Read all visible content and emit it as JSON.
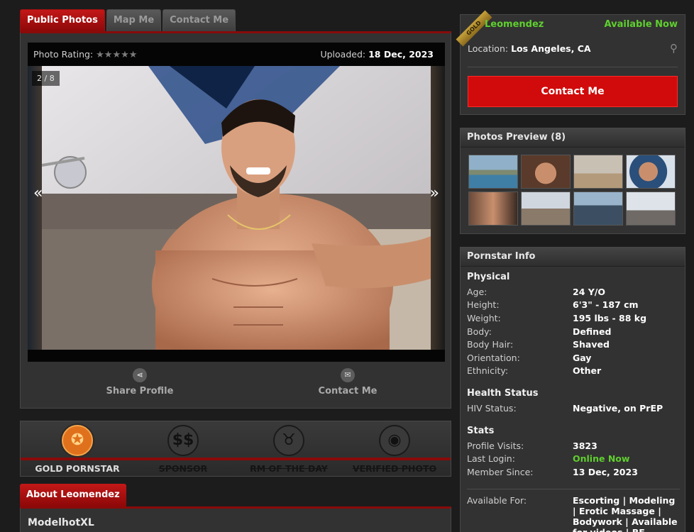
{
  "tabs": [
    {
      "label": "Public Photos",
      "active": true
    },
    {
      "label": "Map Me",
      "active": false
    },
    {
      "label": "Contact Me",
      "active": false
    }
  ],
  "photo": {
    "rating_label": "Photo Rating:",
    "stars": "★★★★★",
    "uploaded_label": "Uploaded:",
    "uploaded_date": "18 Dec, 2023",
    "counter": "2 / 8",
    "prev": "«",
    "next": "»"
  },
  "actions": {
    "share_label": "Share Profile",
    "contact_label": "Contact Me"
  },
  "badges": [
    {
      "label": "GOLD PORNSTAR",
      "active": true,
      "icon": "medal-icon",
      "glyph": "✪"
    },
    {
      "label": "SPONSOR",
      "active": false,
      "icon": "dollar-icon",
      "glyph": "$$"
    },
    {
      "label": "RM OF THE DAY",
      "active": false,
      "icon": "devil-icon",
      "glyph": "♉"
    },
    {
      "label": "VERIFIED PHOTO",
      "active": false,
      "icon": "camera-icon",
      "glyph": "◉"
    }
  ],
  "about": {
    "tab_label": "About Leomendez",
    "name": "ModelhotXL"
  },
  "profile": {
    "ribbon": "GOLD",
    "username": "Leomendez",
    "availability": "Available Now",
    "location_label": "Location:",
    "location": "Los Angeles, CA",
    "contact_button": "Contact Me"
  },
  "preview": {
    "title": "Photos Preview (8)"
  },
  "info": {
    "title": "Pornstar Info",
    "physical_title": "Physical",
    "physical": [
      {
        "k": "Age:",
        "v": "24 Y/O"
      },
      {
        "k": "Height:",
        "v": "6'3\" - 187 cm"
      },
      {
        "k": "Weight:",
        "v": "195 lbs - 88 kg"
      },
      {
        "k": "Body:",
        "v": "Defined"
      },
      {
        "k": "Body Hair:",
        "v": "Shaved"
      },
      {
        "k": "Orientation:",
        "v": "Gay"
      },
      {
        "k": "Ethnicity:",
        "v": "Other"
      }
    ],
    "health_title": "Health Status",
    "health": [
      {
        "k": "HIV Status:",
        "v": "Negative, on PrEP"
      }
    ],
    "stats_title": "Stats",
    "stats": [
      {
        "k": "Profile Visits:",
        "v": "3823"
      },
      {
        "k": "Last Login:",
        "v": "Online Now"
      },
      {
        "k": "Member Since:",
        "v": "13 Dec, 2023"
      }
    ],
    "available_for_label": "Available For:",
    "available_for": "Escorting | Modeling | Erotic Massage | Bodywork | Available for videos | BF"
  },
  "colors": {
    "accent_red": "#d10b0b",
    "online_green": "#5fcf2f",
    "gold": "#e0711c"
  }
}
